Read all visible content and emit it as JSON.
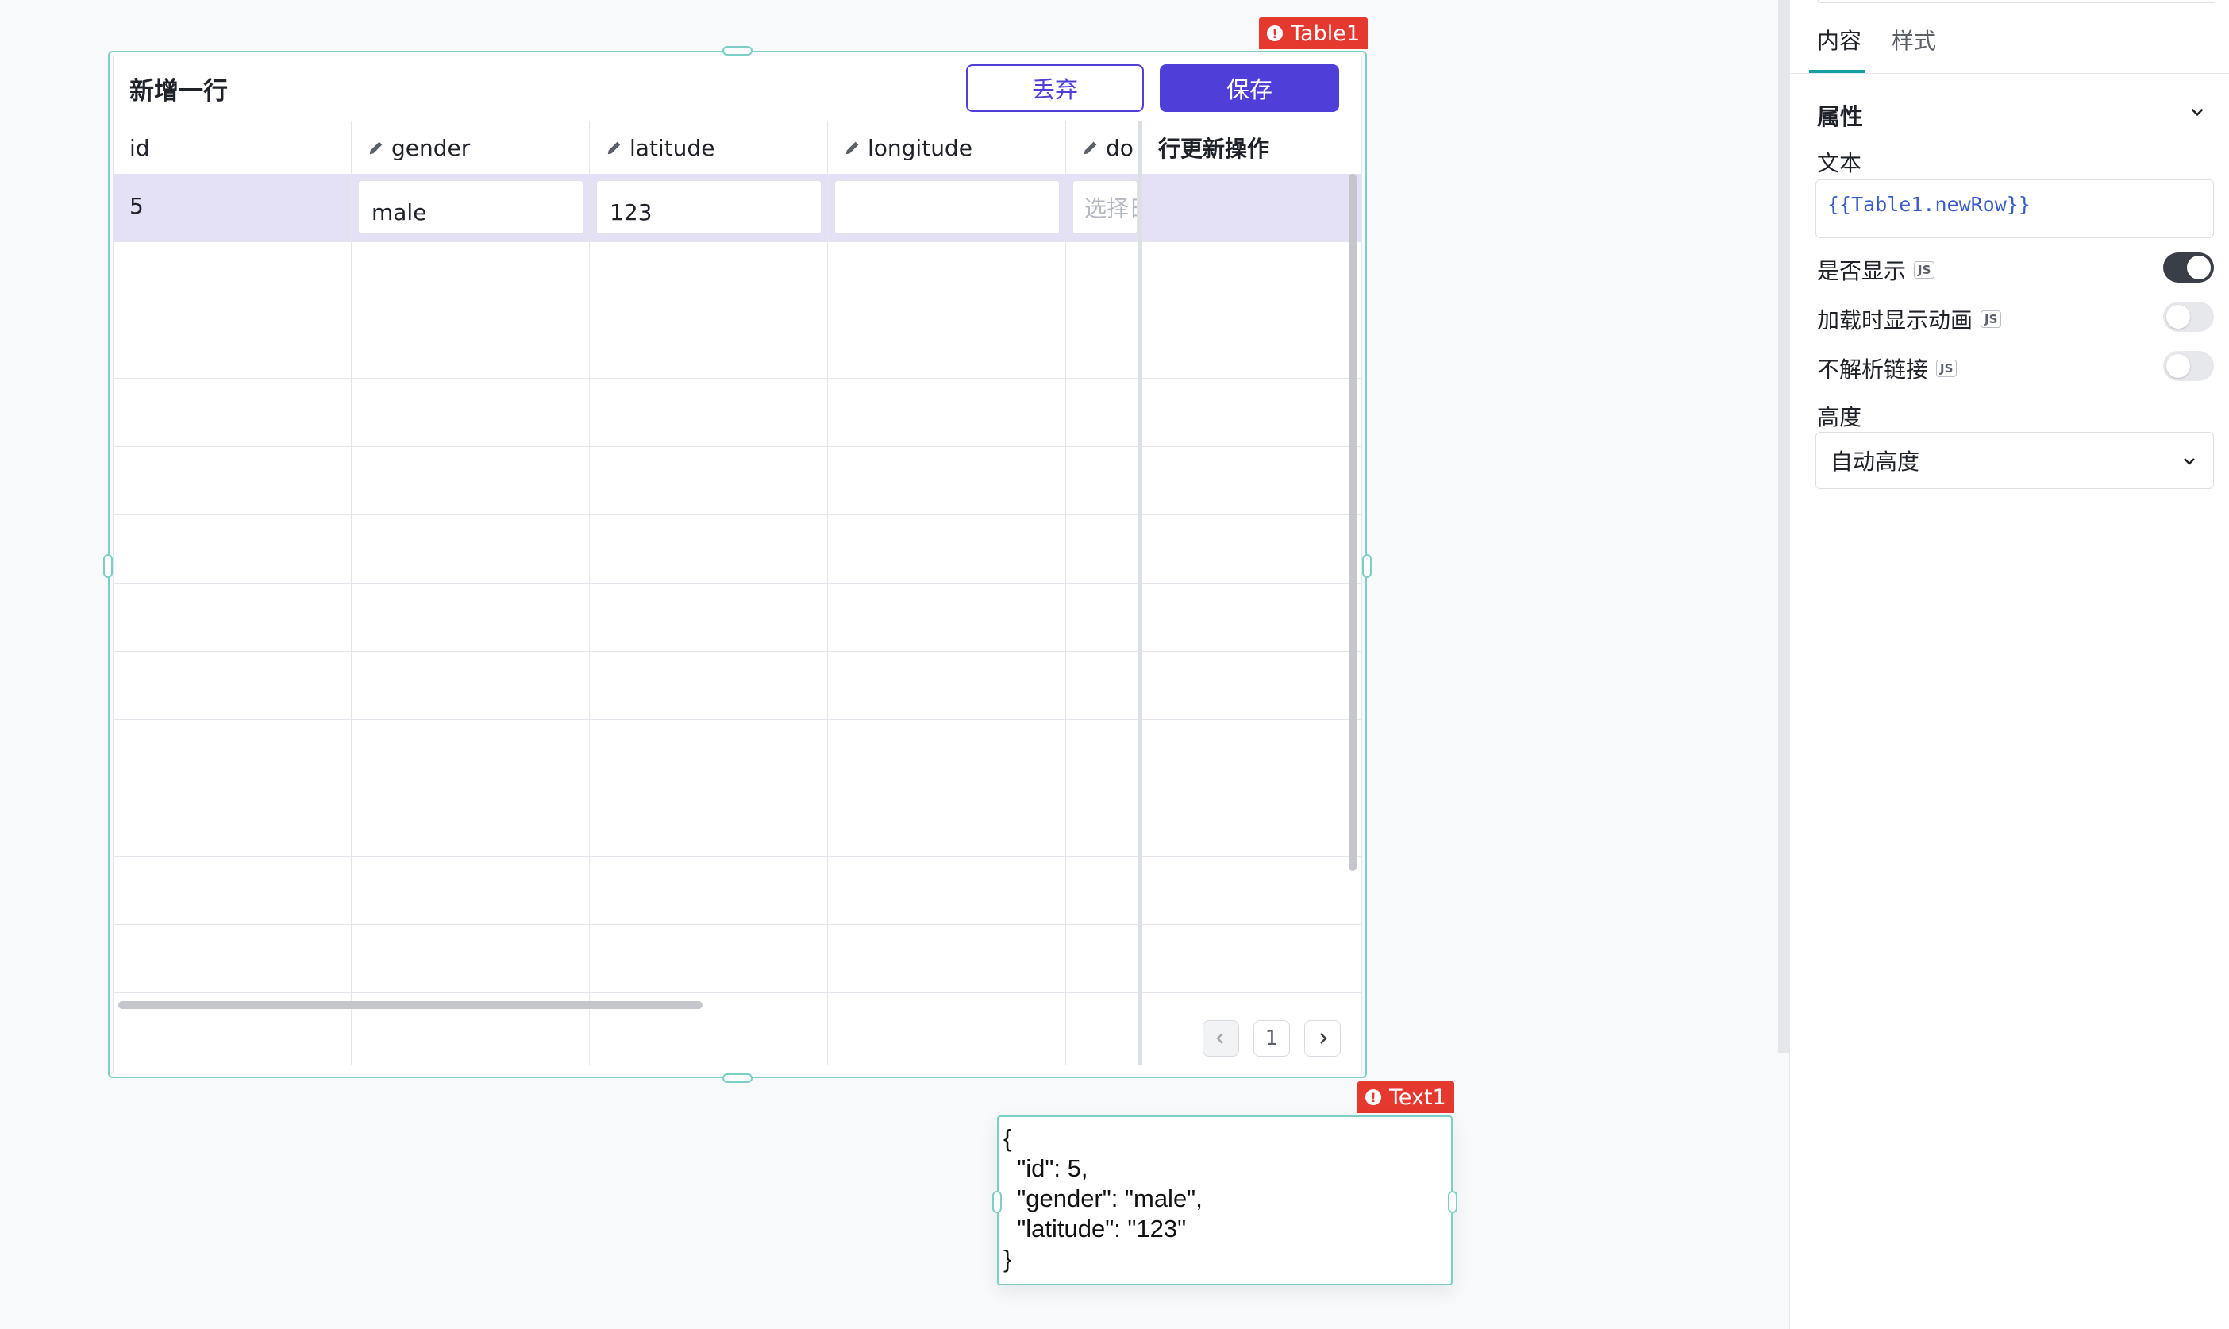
{
  "canvas": {
    "table_component": {
      "badge_label": "Table1",
      "title": "新增一行",
      "discard_label": "丢弃",
      "save_label": "保存",
      "columns": [
        {
          "label": "id",
          "editable": false
        },
        {
          "label": "gender",
          "editable": true
        },
        {
          "label": "latitude",
          "editable": true
        },
        {
          "label": "longitude",
          "editable": true
        },
        {
          "label": "do",
          "editable": true
        },
        {
          "label": "行更新操作",
          "editable": false
        }
      ],
      "new_row": {
        "id": "5",
        "gender": "male",
        "latitude": "123",
        "longitude": "",
        "do_placeholder": "选择日"
      },
      "pagination": {
        "current_page": "1"
      }
    },
    "text_component": {
      "badge_label": "Text1",
      "content": "{\n  \"id\": 5,\n  \"gender\": \"male\",\n  \"latitude\": \"123\"\n}"
    }
  },
  "panel": {
    "tabs": [
      {
        "label": "内容",
        "active": true
      },
      {
        "label": "样式",
        "active": false
      }
    ],
    "section_title": "属性",
    "text_label": "文本",
    "text_value": "{{Table1.newRow}}",
    "js_tag": "JS",
    "toggles": [
      {
        "label": "是否显示",
        "on": true
      },
      {
        "label": "加载时显示动画",
        "on": false
      },
      {
        "label": "不解析链接",
        "on": false
      }
    ],
    "height_label": "高度",
    "height_value": "自动高度"
  },
  "colors": {
    "primary": "#4f3fd8",
    "selection_row": "#e4e1f7",
    "frame_teal": "#7ccfc7",
    "badge_red": "#e5382f",
    "tab_underline": "#16a0a0"
  }
}
